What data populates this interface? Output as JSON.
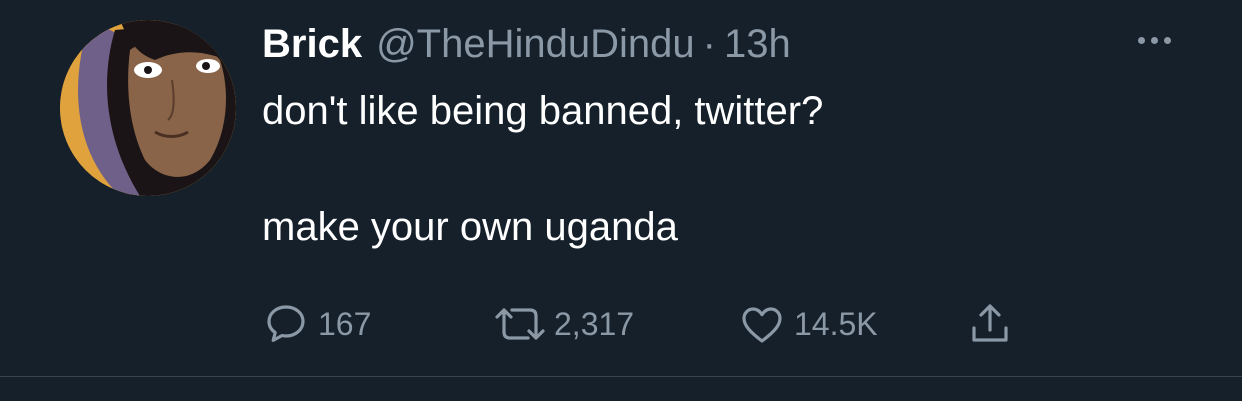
{
  "tweet": {
    "display_name": "Brick",
    "handle": "@TheHinduDindu",
    "separator": "·",
    "time": "13h",
    "text_lines": [
      "don't like being banned, twitter?",
      "make your own uganda"
    ],
    "replies": "167",
    "retweets": "2,317",
    "likes": "14.5K"
  },
  "icons": {
    "more": "more-horizontal-icon",
    "reply": "speech-bubble-icon",
    "retweet": "retweet-arrows-icon",
    "like": "heart-outline-icon",
    "share": "share-upload-icon"
  },
  "colors": {
    "background": "#15202b",
    "text": "#ffffff",
    "secondary": "#8b98a5",
    "divider": "#38444d"
  }
}
